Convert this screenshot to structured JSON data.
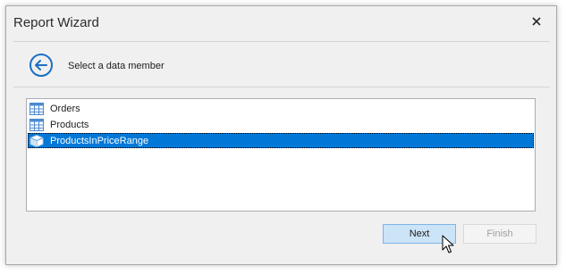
{
  "window": {
    "title": "Report Wizard",
    "close_icon": "close-icon"
  },
  "header": {
    "back_icon": "back-arrow-icon",
    "text": "Select a data member"
  },
  "list": {
    "items": [
      {
        "label": "Orders",
        "icon": "table-icon",
        "selected": false
      },
      {
        "label": "Products",
        "icon": "table-icon",
        "selected": false
      },
      {
        "label": "ProductsInPriceRange",
        "icon": "stored-procedure-icon",
        "selected": true
      }
    ]
  },
  "buttons": {
    "next_label": "Next",
    "finish_label": "Finish",
    "finish_enabled": false
  },
  "colors": {
    "accent": "#0078d7",
    "selection": "#0078d7",
    "next_button_bg": "#cce4f7"
  }
}
